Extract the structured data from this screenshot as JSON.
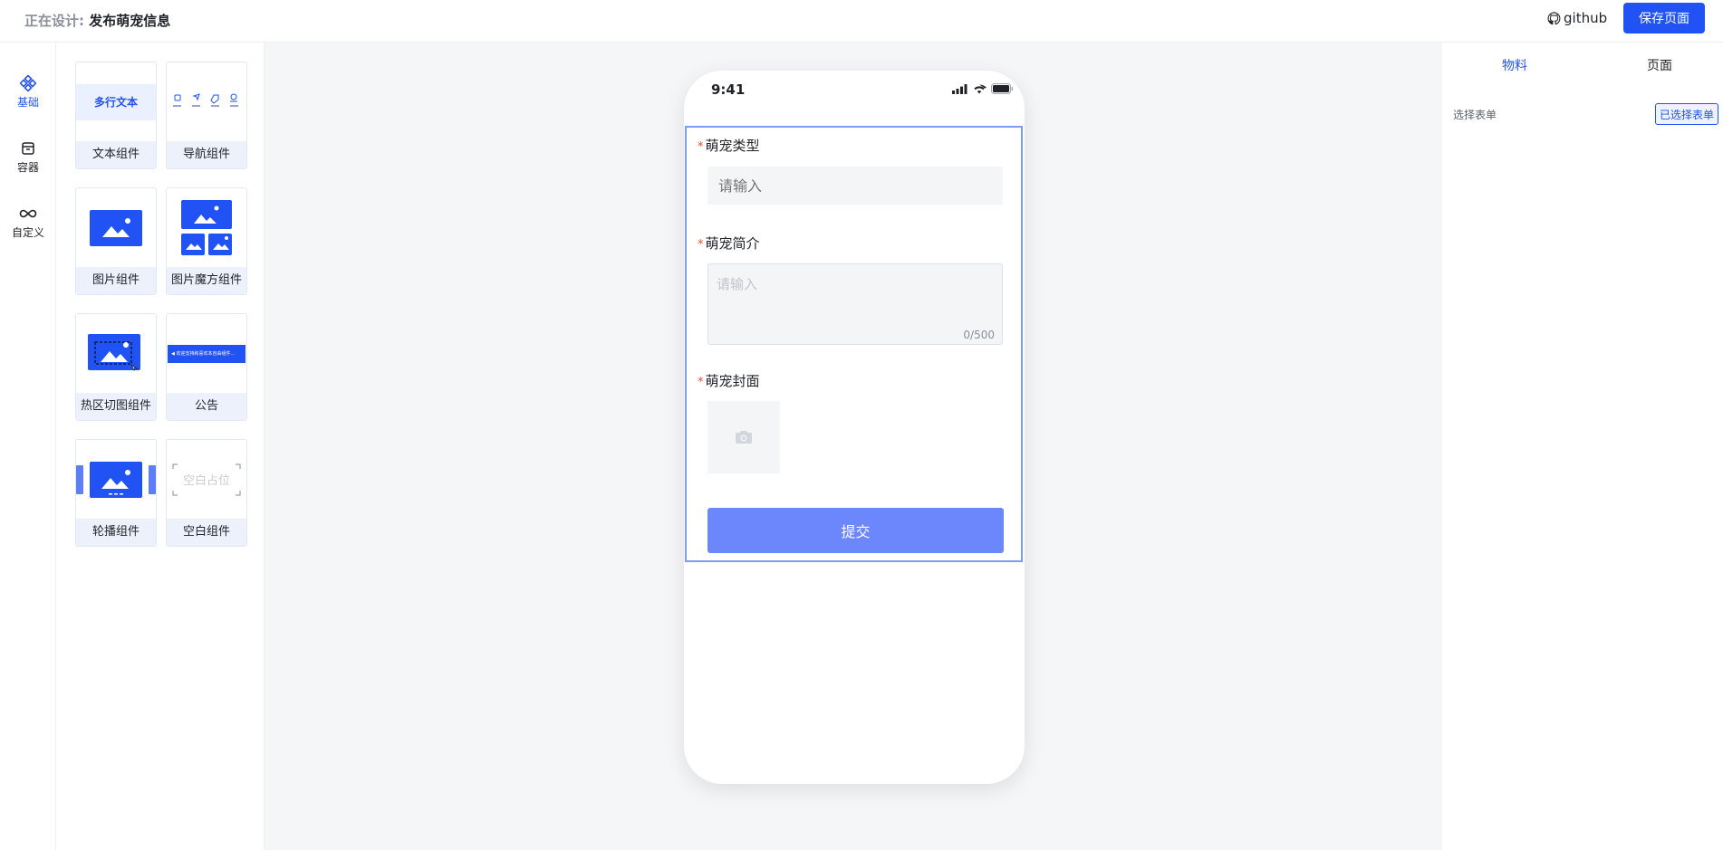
{
  "header": {
    "design_prefix": "正在设计:",
    "design_name": "发布萌宠信息",
    "github_label": "github",
    "save_label": "保存页面"
  },
  "rail": {
    "items": [
      {
        "label": "基础",
        "icon": "basic-components-icon",
        "active": true
      },
      {
        "label": "容器",
        "icon": "container-icon",
        "active": false
      },
      {
        "label": "自定义",
        "icon": "infinity-icon",
        "active": false
      }
    ]
  },
  "palette": {
    "items": [
      {
        "label": "文本组件",
        "preview_text": "多行文本"
      },
      {
        "label": "导航组件"
      },
      {
        "label": "图片组件"
      },
      {
        "label": "图片魔方组件"
      },
      {
        "label": "热区切图组件"
      },
      {
        "label": "公告",
        "preview_text": "欢迎支持和喜欢本自由组件..."
      },
      {
        "label": "轮播组件"
      },
      {
        "label": "空白组件",
        "preview_text": "空白占位"
      }
    ]
  },
  "phone": {
    "time": "9:41",
    "form": {
      "fields": [
        {
          "label": "萌宠类型",
          "required": true,
          "placeholder": "请输入"
        },
        {
          "label": "萌宠简介",
          "required": true,
          "placeholder": "请输入",
          "count": "0/500"
        },
        {
          "label": "萌宠封面",
          "required": true
        }
      ],
      "submit_label": "提交"
    }
  },
  "right_panel": {
    "tabs": [
      {
        "label": "物料",
        "active": true
      },
      {
        "label": "页面",
        "active": false
      }
    ],
    "select_form_label": "选择表单",
    "select_form_button": "已选择表单"
  },
  "colors": {
    "primary": "#2152f3",
    "submit": "#6b87fb",
    "required": "#ee4d2d",
    "canvas_bg": "#f5f6f8"
  }
}
